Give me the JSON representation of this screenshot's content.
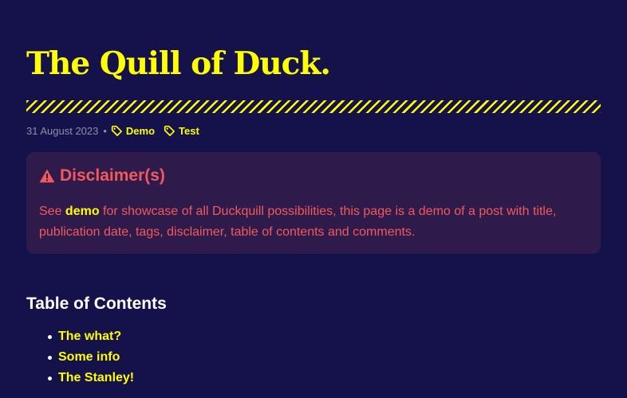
{
  "post": {
    "title": "The Quill of Duck.",
    "date": "31 August 2023",
    "separator": "•",
    "tags": [
      {
        "label": "Demo",
        "icon": "tag-icon"
      },
      {
        "label": "Test",
        "icon": "tag-icon"
      }
    ]
  },
  "disclaimer": {
    "icon": "warning-triangle-icon",
    "title": "Disclaimer(s)",
    "text_before": "See ",
    "link": "demo",
    "text_after": " for showcase of all Duckquill possibilities, this page is a demo of a post with title, publication date, tags, disclaimer, table of contents and comments."
  },
  "toc": {
    "title": "Table of Contents",
    "items": [
      {
        "label": "The what?"
      },
      {
        "label": "Some info"
      },
      {
        "label": "The Stanley!"
      }
    ]
  },
  "colors": {
    "background": "#15114a",
    "accent": "#ffff00",
    "warning": "#f2595c",
    "disclaimer_bg": "#2e1b4b",
    "muted": "#8e8db0"
  }
}
